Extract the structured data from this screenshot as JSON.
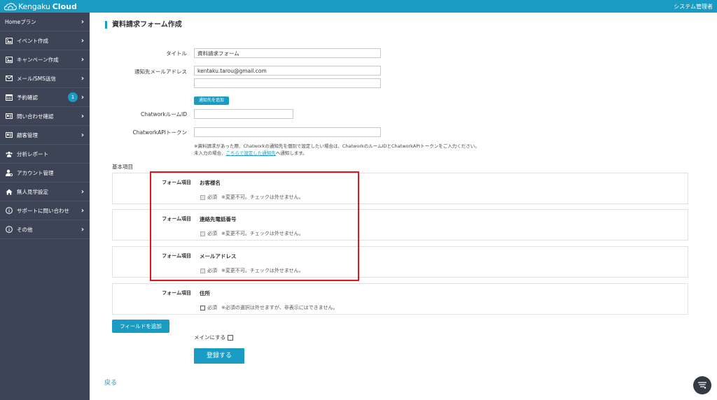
{
  "header": {
    "brand_a": "Kengaku",
    "brand_b": "Cloud",
    "user_label": "システム管理者"
  },
  "sidebar": {
    "items": [
      {
        "label": "Homeプラン",
        "icon": "none",
        "chevron": true
      },
      {
        "label": "イベント作成",
        "icon": "image-icon",
        "chevron": true
      },
      {
        "label": "キャンペーン作成",
        "icon": "image-icon",
        "chevron": true
      },
      {
        "label": "メール/SMS送信",
        "icon": "envelope-icon",
        "chevron": true
      },
      {
        "label": "予約確認",
        "icon": "calendar-icon",
        "chevron": true,
        "badge": "1"
      },
      {
        "label": "問い合わせ確認",
        "icon": "id-card-icon",
        "chevron": true
      },
      {
        "label": "顧客管理",
        "icon": "id-card-icon",
        "chevron": true
      },
      {
        "label": "分析レポート",
        "icon": "users-icon",
        "chevron": false
      },
      {
        "label": "アカウント管理",
        "icon": "user-gear-icon",
        "chevron": false
      },
      {
        "label": "無人見学設定",
        "icon": "home-icon",
        "chevron": true
      },
      {
        "label": "サポートに問い合わせ",
        "icon": "info-circle-icon",
        "chevron": true
      },
      {
        "label": "その他",
        "icon": "info-circle-icon",
        "chevron": true
      }
    ]
  },
  "page": {
    "title": "資料請求フォーム作成"
  },
  "form": {
    "title_label": "タイトル",
    "title_value": "資料請求フォーム",
    "notify_email_label": "通知先メールアドレス",
    "notify_email_value": "kentaku.tarou@gmail.com",
    "notify_email_value2": "",
    "add_notify_button": "通知先を追加",
    "chatwork_room_label": "ChatworkルームID",
    "chatwork_room_value": "",
    "chatwork_token_label": "ChatworkAPIトークン",
    "chatwork_token_value": "",
    "note_line1": "※資料請求があった際、Chatworkの通知先を個別で設定したい場合は、ChatworkのルームIDとChatworkAPIトークンをご入力ください。",
    "note_line2_pre": "未入力の場合、",
    "note_line2_link": "こちらで設定した通知先",
    "note_line2_post": "へ通知します。"
  },
  "basic_section": {
    "label": "基本項目",
    "fields": [
      {
        "item_label": "フォーム項目",
        "name": "お客様名",
        "required_label": "必須",
        "note": "※変更不可。チェックは外せません。",
        "checked": true,
        "disabled": true
      },
      {
        "item_label": "フォーム項目",
        "name": "連絡先電話番号",
        "required_label": "必須",
        "note": "※変更不可。チェックは外せません。",
        "checked": true,
        "disabled": true
      },
      {
        "item_label": "フォーム項目",
        "name": "メールアドレス",
        "required_label": "必須",
        "note": "※変更不可。チェックは外せません。",
        "checked": true,
        "disabled": true
      },
      {
        "item_label": "フォーム項目",
        "name": "住所",
        "required_label": "必須",
        "note": "※必須の選択は外せますが、非表示にはできません。",
        "checked": false,
        "disabled": false
      }
    ]
  },
  "actions": {
    "add_field_button": "フィールドを追加",
    "main_checkbox_label": "メインにする",
    "submit_button": "登録する",
    "back_link": "戻る"
  },
  "colors": {
    "accent": "#1a9bc3",
    "sidebar_bg": "#3d4456",
    "highlight": "#e0161b"
  }
}
